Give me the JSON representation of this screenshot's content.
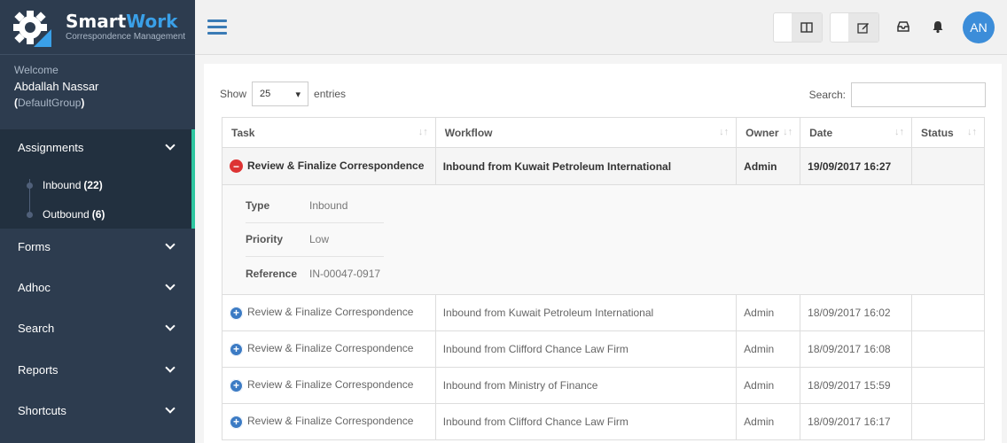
{
  "brand": {
    "title_a": "Smart",
    "title_b": "Work",
    "subtitle": "Correspondence Management"
  },
  "user": {
    "welcome": "Welcome",
    "name": "Abdallah Nassar",
    "group_open": "(",
    "group": "DefaultGroup",
    "group_close": ")"
  },
  "sidebar": {
    "assignments": "Assignments",
    "inbound_label": "Inbound",
    "inbound_count": "(22)",
    "outbound_label": "Outbound",
    "outbound_count": "(6)",
    "forms": "Forms",
    "adhoc": "Adhoc",
    "search": "Search",
    "reports": "Reports",
    "shortcuts": "Shortcuts"
  },
  "topbar": {
    "avatar": "AN"
  },
  "table_controls": {
    "show": "Show",
    "entries_value": "25",
    "entries": "entries",
    "search_label": "Search:"
  },
  "table": {
    "headers": [
      "Task",
      "Workflow",
      "Owner",
      "Date",
      "Status"
    ],
    "open_row": {
      "task": "Review & Finalize Correspondence",
      "workflow": "Inbound from Kuwait Petroleum International",
      "owner": "Admin",
      "date": "19/09/2017 16:27",
      "status": ""
    },
    "details": [
      {
        "key": "Type",
        "value": "Inbound"
      },
      {
        "key": "Priority",
        "value": "Low"
      },
      {
        "key": "Reference",
        "value": "IN-00047-0917"
      }
    ],
    "rows": [
      {
        "task": "Review & Finalize Correspondence",
        "workflow": "Inbound from Kuwait Petroleum International",
        "owner": "Admin",
        "date": "18/09/2017 16:02",
        "status": ""
      },
      {
        "task": "Review & Finalize Correspondence",
        "workflow": "Inbound from Clifford Chance Law Firm",
        "owner": "Admin",
        "date": "18/09/2017 16:08",
        "status": ""
      },
      {
        "task": "Review & Finalize Correspondence",
        "workflow": "Inbound from Ministry of Finance",
        "owner": "Admin",
        "date": "18/09/2017 15:59",
        "status": ""
      },
      {
        "task": "Review & Finalize Correspondence",
        "workflow": "Inbound from Clifford Chance Law Firm",
        "owner": "Admin",
        "date": "18/09/2017 16:17",
        "status": ""
      }
    ]
  }
}
